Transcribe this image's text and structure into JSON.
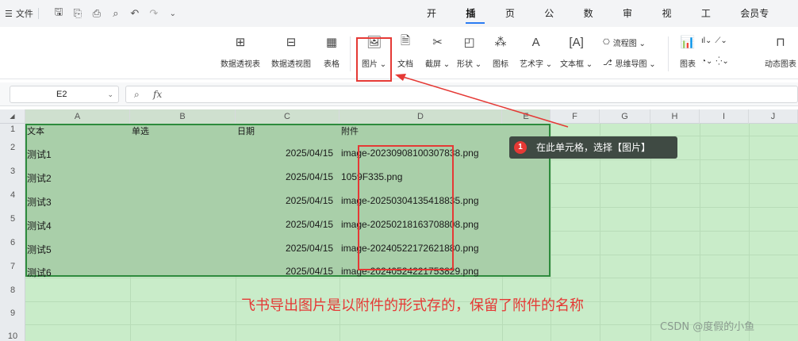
{
  "menu": {
    "file_label": "文件",
    "tabs": [
      "开始",
      "插入",
      "页面",
      "公式",
      "数据",
      "审阅",
      "视图",
      "工具",
      "会员专享"
    ],
    "active_tab": "插入"
  },
  "ribbon": {
    "items": [
      {
        "label": "数据透视表",
        "icon": "pivot-table-icon"
      },
      {
        "label": "数据透视图",
        "icon": "pivot-chart-icon"
      },
      {
        "label": "表格",
        "icon": "table-icon"
      },
      {
        "label": "图片 ⌄",
        "icon": "picture-icon"
      },
      {
        "label": "文档",
        "icon": "document-icon"
      },
      {
        "label": "截屏 ⌄",
        "icon": "screenshot-icon"
      },
      {
        "label": "形状 ⌄",
        "icon": "shape-icon"
      },
      {
        "label": "图标",
        "icon": "icon-library-icon"
      },
      {
        "label": "艺术字 ⌄",
        "icon": "wordart-icon"
      },
      {
        "label": "文本框 ⌄",
        "icon": "textbox-icon"
      }
    ],
    "flowchart": "流程图 ⌄",
    "mindmap": "思维导图 ⌄",
    "chart": "图表",
    "dynamic_chart": "动态图表"
  },
  "formula_bar": {
    "name_box": "E2",
    "fx_label": "fx"
  },
  "columns": [
    "A",
    "B",
    "C",
    "D",
    "E",
    "F",
    "G",
    "H",
    "I",
    "J"
  ],
  "rows": [
    "1",
    "2",
    "3",
    "4",
    "5",
    "6",
    "7",
    "8",
    "9",
    "10"
  ],
  "table": {
    "headers": [
      "文本",
      "单选",
      "日期",
      "附件"
    ],
    "data": [
      {
        "text": "测试1",
        "date": "2025/04/15",
        "file": "image-20230908100307838.png"
      },
      {
        "text": "测试2",
        "date": "2025/04/15",
        "file": "1059F335.png"
      },
      {
        "text": "测试3",
        "date": "2025/04/15",
        "file": "image-20250304135418835.png"
      },
      {
        "text": "测试4",
        "date": "2025/04/15",
        "file": "image-20250218163708808.png"
      },
      {
        "text": "测试5",
        "date": "2025/04/15",
        "file": "image-20240522172621880.png"
      },
      {
        "text": "测试6",
        "date": "2025/04/15",
        "file": "image-20240524221753829.png"
      }
    ]
  },
  "tooltip": {
    "badge": "1",
    "text": "在此单元格，选择【图片】"
  },
  "caption": "飞书导出图片是以附件的形式存的，保留了附件的名称",
  "watermark": "CSDN @度假的小鱼",
  "colors": {
    "accent": "#2b7cf2",
    "highlight_red": "#e53935",
    "selection_green": "#2e8b3d",
    "sheet_bg": "#c9ecc9"
  }
}
